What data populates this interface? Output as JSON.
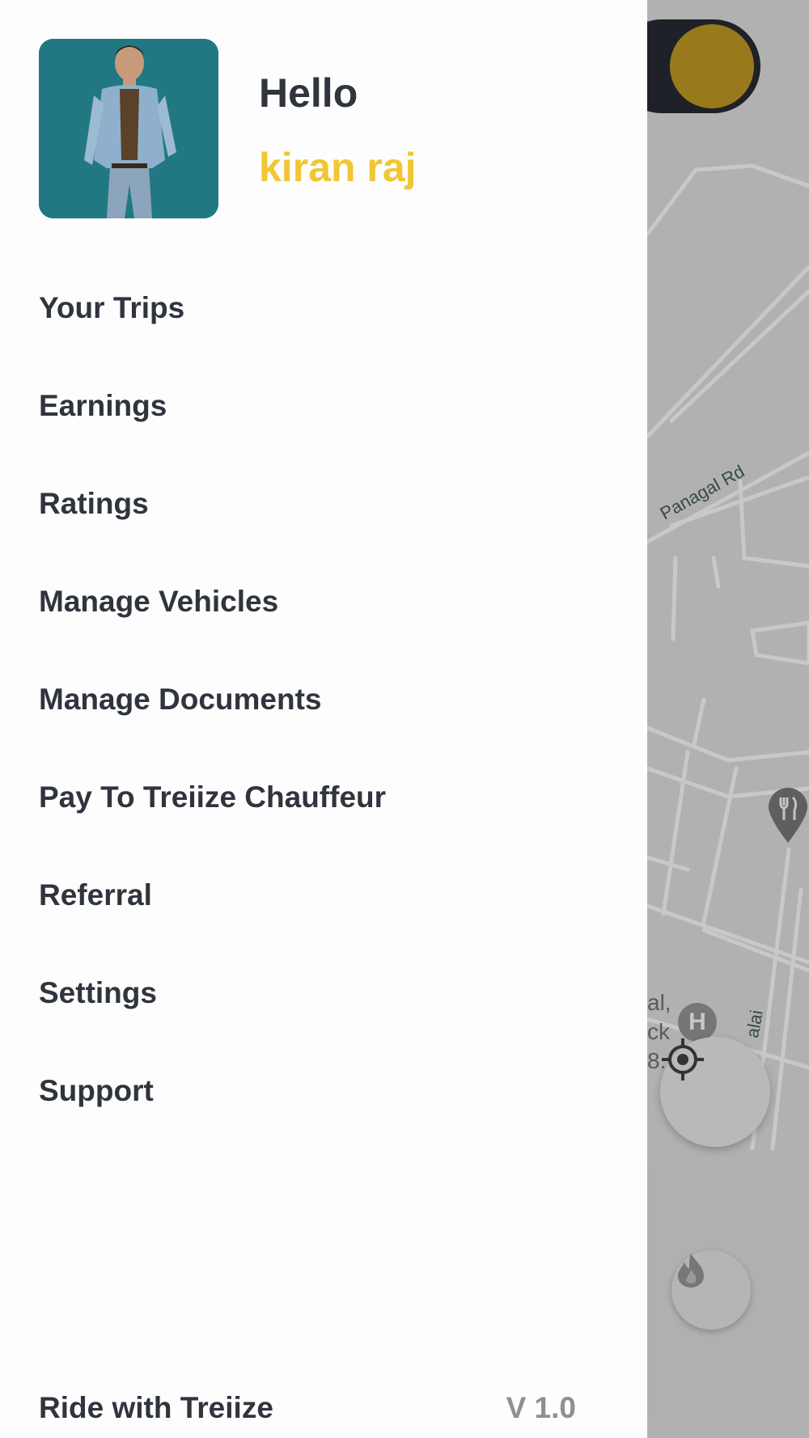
{
  "profile": {
    "greeting": "Hello",
    "name": "kiran raj",
    "avatar_icon": "profile-photo"
  },
  "menu": [
    {
      "label": "Your Trips"
    },
    {
      "label": "Earnings"
    },
    {
      "label": "Ratings"
    },
    {
      "label": "Manage Vehicles"
    },
    {
      "label": "Manage Documents"
    },
    {
      "label": "Pay To Treiize Chauffeur"
    },
    {
      "label": "Referral"
    },
    {
      "label": "Settings"
    },
    {
      "label": "Support"
    }
  ],
  "footer": {
    "label": "Ride with Treiize",
    "version": "V 1.0"
  },
  "map": {
    "road_label": "Panagal Rd",
    "poi_label": "al,\nck\n8..",
    "side_road_label": "alai",
    "hospital_symbol": "H",
    "locate_icon": "my-location-icon",
    "flame_icon": "flame-icon",
    "pin_icon": "restaurant-pin-icon"
  },
  "colors": {
    "accent": "#f1c632",
    "toggle_knob": "#b18f22",
    "toggle_track": "#24272e",
    "text": "#2f343d",
    "version_text": "#8e8f93"
  }
}
